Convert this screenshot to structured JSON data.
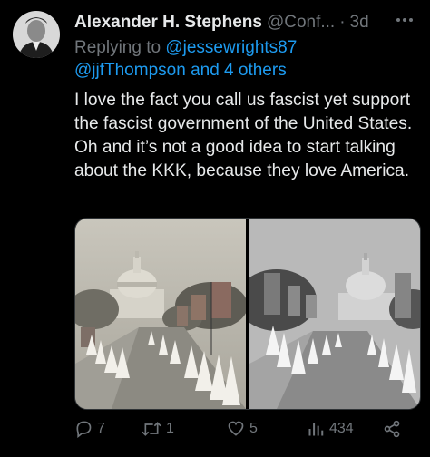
{
  "tweet": {
    "author": {
      "display_name": "Alexander H. Stephens",
      "handle": "@Conf...",
      "time": "3d",
      "separator": "·"
    },
    "reply": {
      "prefix": "Replying to",
      "mention_1": "@jessewrights87",
      "mention_2": "@jjfThompson",
      "connector": "and",
      "others": "4 others"
    },
    "text": "I love the fact you call us fascist yet support the fascist government of the United States. Oh and it’s not a good idea to start talking about the KKK, because they love America.",
    "media": [
      {
        "icon": "photo-kkk-march-capitol-color"
      },
      {
        "icon": "photo-kkk-march-capitol-bw"
      }
    ],
    "actions": {
      "replies": "7",
      "retweets": "1",
      "likes": "5",
      "views": "434"
    }
  },
  "colors": {
    "background": "#000000",
    "text": "#e7e9ea",
    "muted": "#71767b",
    "link": "#1d9bf0"
  }
}
